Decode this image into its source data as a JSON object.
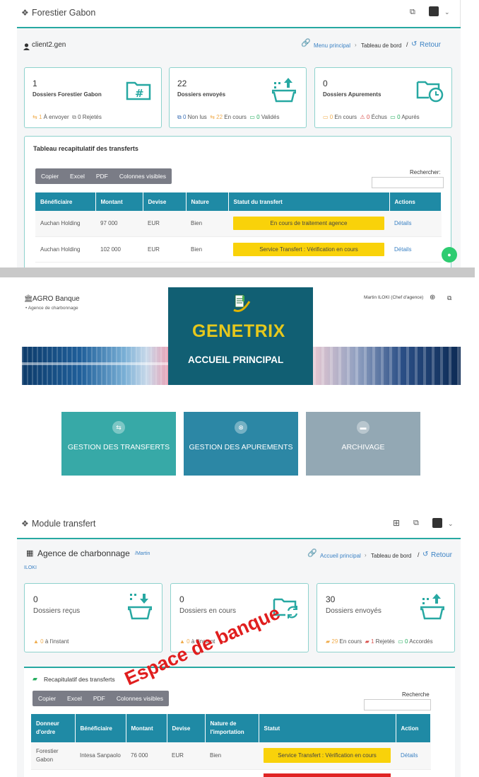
{
  "s1": {
    "app_title": "Forestier Gabon",
    "user": "client2.gen",
    "breadcrumb": {
      "home": "Menu principal",
      "sep": "›",
      "current": "Tableau de bord",
      "slash": "/",
      "back": "Retour"
    },
    "cards": [
      {
        "count": "1",
        "label": "Dossiers Forestier Gabon",
        "footer": [
          {
            "v": "1",
            "t": "À envoyer",
            "c": "orange"
          },
          {
            "v": "0",
            "t": "Rejetés",
            "c": "gray"
          }
        ]
      },
      {
        "count": "22",
        "label": "Dossiers envoyés",
        "footer": [
          {
            "v": "0",
            "t": "Non lus",
            "c": "blue"
          },
          {
            "v": "22",
            "t": "En cours",
            "c": "orange"
          },
          {
            "v": "0",
            "t": "Validés",
            "c": "green"
          }
        ]
      },
      {
        "count": "0",
        "label": "Dossiers Apurements",
        "footer": [
          {
            "v": "0",
            "t": "En cours",
            "c": "orange"
          },
          {
            "v": "0",
            "t": "Échus",
            "c": "red"
          },
          {
            "v": "0",
            "t": "Apurés",
            "c": "green"
          }
        ]
      }
    ],
    "table_title": "Tableau recapitulatif des transferts",
    "buttons": [
      "Copier",
      "Excel",
      "PDF",
      "Colonnes visibles"
    ],
    "search_label": "Rechercher:",
    "columns": [
      "Bénéficiaire",
      "Montant",
      "Devise",
      "Nature",
      "Statut du transfert",
      "Actions"
    ],
    "rows": [
      {
        "benef": "Auchan Holding",
        "montant": "97 000",
        "devise": "EUR",
        "nature": "Bien",
        "statut": "En cours de traitement agence",
        "action": "Détails"
      },
      {
        "benef": "Auchan Holding",
        "montant": "102 000",
        "devise": "EUR",
        "nature": "Bien",
        "statut": "Service Transfert : Vérification en cours",
        "action": "Détails"
      }
    ]
  },
  "s2": {
    "bank": "AGRO Banque",
    "agency": "Agence de charbonnage",
    "user": "Martin ILOKI (Chef d'agence)",
    "logo_text": "GENETRIX",
    "banner_title": "ACCUEIL PRINCIPAL",
    "tiles": [
      {
        "label": "GESTION DES TRANSFERTS",
        "color": "#37a9a7"
      },
      {
        "label": "GESTION DES APUREMENTS",
        "color": "#2c87a5"
      },
      {
        "label": "ARCHIVAGE",
        "color": "#93a8b4"
      }
    ]
  },
  "s3": {
    "app_title": "Module transfert",
    "agency": "Agence de charbonnage",
    "user_prefix": "/Martin",
    "user_suffix": "ILOKI",
    "breadcrumb": {
      "home": "Accueil principal",
      "sep": "›",
      "current": "Tableau de bord",
      "slash": "/",
      "back": "Retour"
    },
    "cards": [
      {
        "count": "0",
        "label": "Dossiers reçus",
        "footer": [
          {
            "v": "0",
            "t": "à l'instant",
            "c": "orange"
          }
        ]
      },
      {
        "count": "0",
        "label": "Dossiers en cours",
        "footer": [
          {
            "v": "0",
            "t": "à l'instant",
            "c": "orange"
          }
        ]
      },
      {
        "count": "30",
        "label": "Dossiers envoyés",
        "footer": [
          {
            "v": "29",
            "t": "En cours",
            "c": "orange"
          },
          {
            "v": "1",
            "t": "Rejetés",
            "c": "red"
          },
          {
            "v": "0",
            "t": "Accordés",
            "c": "green"
          }
        ]
      }
    ],
    "table_title": "Recapitulatif des transferts",
    "buttons": [
      "Copier",
      "Excel",
      "PDF",
      "Colonnes visibles"
    ],
    "search_label": "Recherche",
    "columns": [
      "Donneur d'ordre",
      "Bénéficiaire",
      "Montant",
      "Devise",
      "Nature de l'importation",
      "Statut",
      "Action"
    ],
    "rows": [
      {
        "donneur": "Forestier Gabon",
        "benef": "Intesa Sanpaolo",
        "montant": "76 000",
        "devise": "EUR",
        "nature": "Bien",
        "statut": "Service Transfert : Vérification en cours",
        "action": "Détails"
      }
    ],
    "overlay_text": "Espace de banque"
  }
}
